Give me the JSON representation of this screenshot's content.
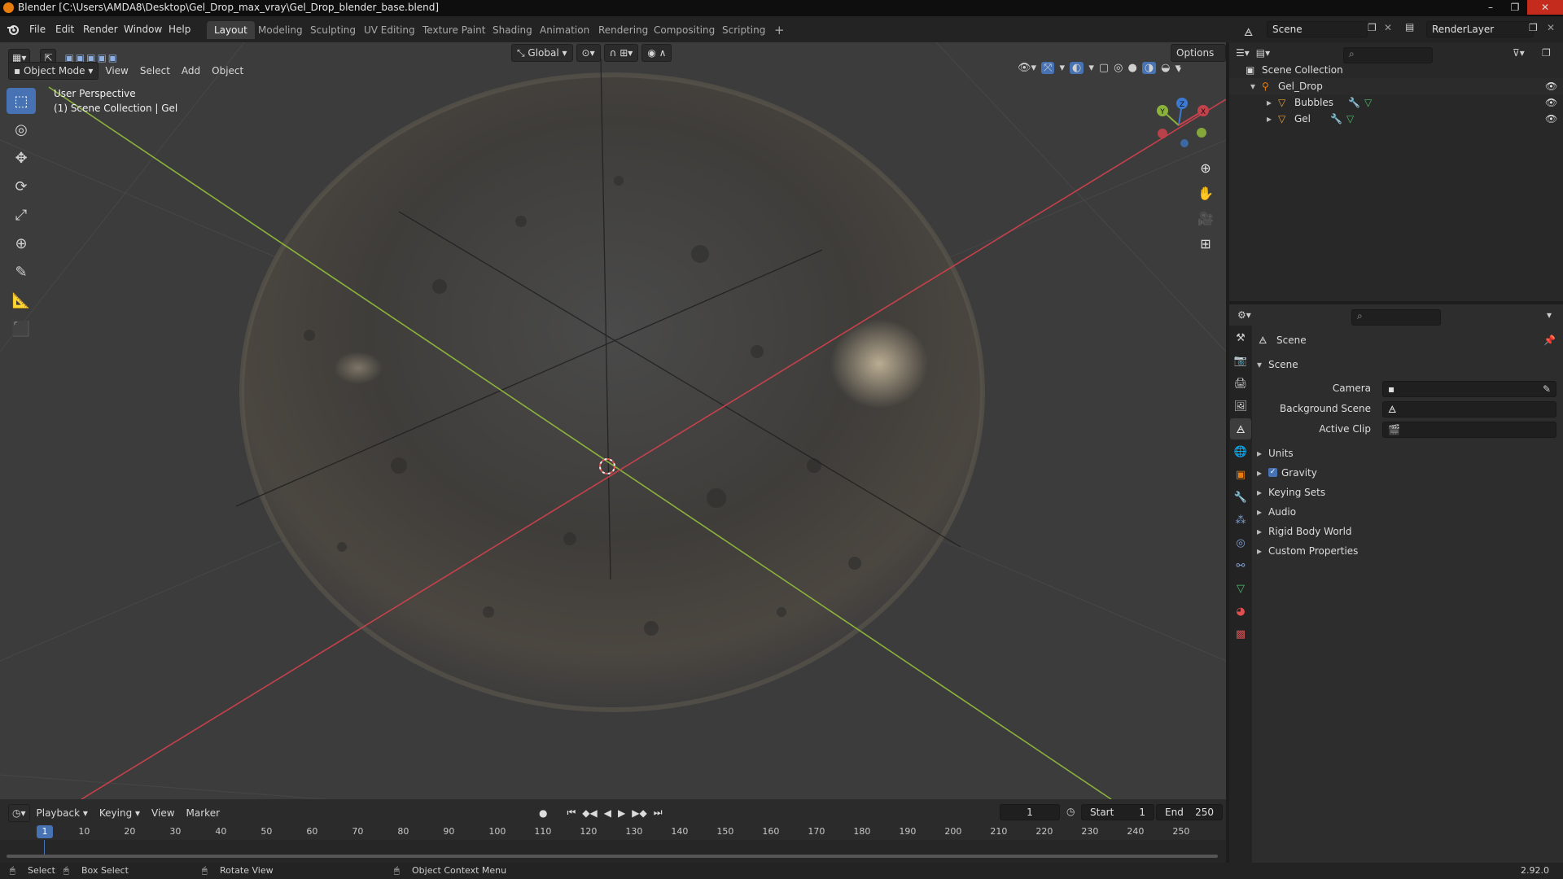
{
  "window": {
    "title": "Blender [C:\\Users\\AMDA8\\Desktop\\Gel_Drop_max_vray\\Gel_Drop_blender_base.blend]",
    "controls": [
      "–",
      "❐",
      "✕"
    ]
  },
  "menu": {
    "items": [
      "File",
      "Edit",
      "Render",
      "Window",
      "Help"
    ]
  },
  "workspaces": {
    "tabs": [
      "Layout",
      "Modeling",
      "Sculpting",
      "UV Editing",
      "Texture Paint",
      "Shading",
      "Animation",
      "Rendering",
      "Compositing",
      "Scripting"
    ],
    "active": "Layout",
    "add": "+"
  },
  "top_right": {
    "scene_label": "Scene",
    "renderlayer_label": "RenderLayer"
  },
  "viewport": {
    "header": {
      "mode": "Object Mode",
      "menus": [
        "View",
        "Select",
        "Add",
        "Object"
      ],
      "orientation": "Global",
      "options": "Options"
    },
    "overlay_text": {
      "perspective": "User Perspective",
      "collection": "(1) Scene Collection | Gel"
    },
    "gizmo_labels": {
      "z": "Z",
      "y": "Y",
      "x": "X"
    },
    "colors": {
      "x_axis": "#c5414b",
      "y_axis": "#8bb33b",
      "z_axis": "#3c7ad1",
      "active_tool": "#4772b3"
    }
  },
  "outliner": {
    "root": "Scene Collection",
    "items": [
      {
        "label": "Gel_Drop",
        "level": 1
      },
      {
        "label": "Bubbles",
        "level": 2
      },
      {
        "label": "Gel",
        "level": 2
      }
    ]
  },
  "properties": {
    "context_title": "Scene",
    "panel_title": "Scene",
    "fields": [
      {
        "label": "Camera",
        "value": ""
      },
      {
        "label": "Background Scene",
        "value": ""
      },
      {
        "label": "Active Clip",
        "value": ""
      }
    ],
    "sections": [
      {
        "label": "Units",
        "checkbox": false
      },
      {
        "label": "Gravity",
        "checkbox": true
      },
      {
        "label": "Keying Sets",
        "checkbox": false
      },
      {
        "label": "Audio",
        "checkbox": false
      },
      {
        "label": "Rigid Body World",
        "checkbox": false
      },
      {
        "label": "Custom Properties",
        "checkbox": false
      }
    ]
  },
  "timeline": {
    "menus": [
      "Playback",
      "Keying",
      "View",
      "Marker"
    ],
    "current_frame": "1",
    "start_label": "Start",
    "start": "1",
    "end_label": "End",
    "end": "250",
    "ruler": [
      "1",
      "10",
      "20",
      "30",
      "40",
      "50",
      "60",
      "70",
      "80",
      "90",
      "100",
      "110",
      "120",
      "130",
      "140",
      "150",
      "160",
      "170",
      "180",
      "190",
      "200",
      "210",
      "220",
      "230",
      "240",
      "250"
    ]
  },
  "statusbar": {
    "items": [
      "Select",
      "Box Select",
      "Rotate View",
      "Object Context Menu"
    ],
    "version": "2.92.0"
  }
}
